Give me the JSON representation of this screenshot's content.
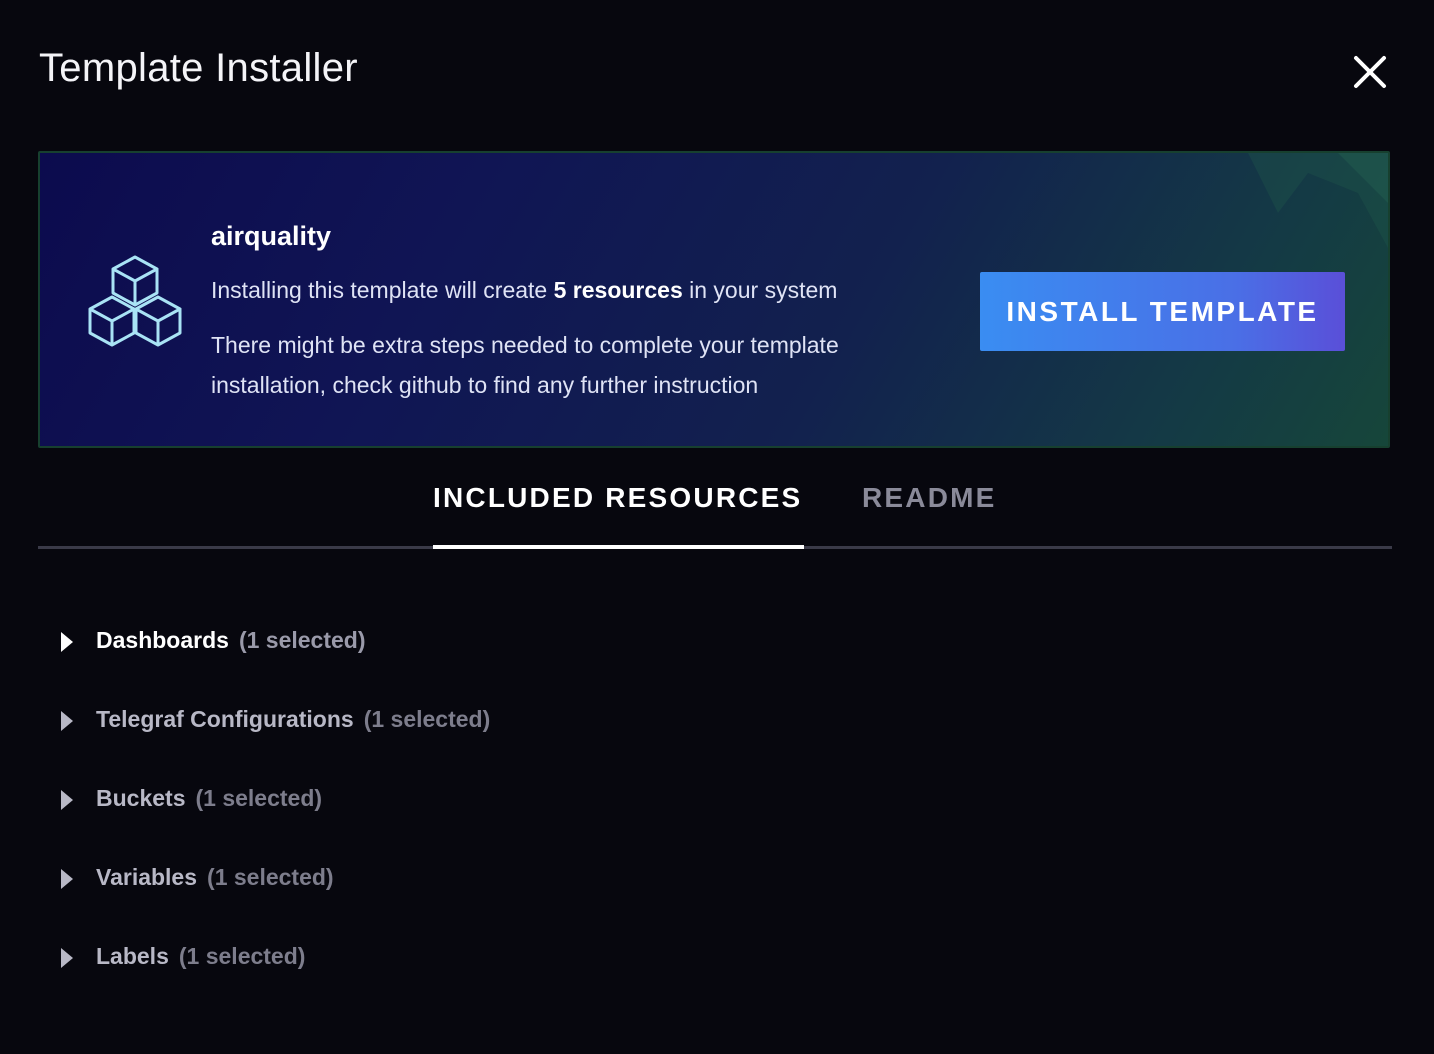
{
  "header": {
    "title": "Template Installer",
    "close_icon": "close-icon"
  },
  "banner": {
    "icon": "cubes-icon",
    "template_name": "airquality",
    "install_prefix": "Installing this template will create",
    "install_count": "5 resources",
    "install_suffix": "in your system",
    "note": "There might be extra steps needed to complete your template installation, check github to find any further instruction",
    "install_button_label": "INSTALL TEMPLATE"
  },
  "tabs": [
    {
      "label": "INCLUDED RESOURCES",
      "active": true
    },
    {
      "label": "README",
      "active": false
    }
  ],
  "resources": [
    {
      "name": "Dashboards",
      "count": "(1 selected)"
    },
    {
      "name": "Telegraf Configurations",
      "count": "(1 selected)"
    },
    {
      "name": "Buckets",
      "count": "(1 selected)"
    },
    {
      "name": "Variables",
      "count": "(1 selected)"
    },
    {
      "name": "Labels",
      "count": "(1 selected)"
    }
  ],
  "colors": {
    "background": "#07070e",
    "button_gradient_start": "#3a8df2",
    "button_gradient_end": "#5a4fd8",
    "banner_border": "#17402f"
  }
}
